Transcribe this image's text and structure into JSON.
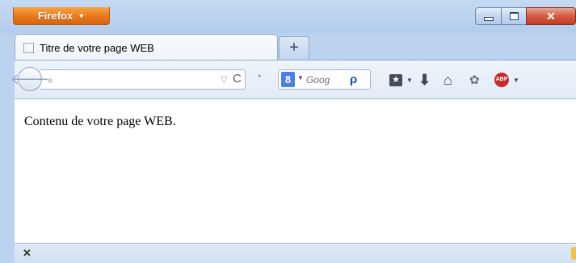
{
  "firefox_menu": {
    "label": "Firefox",
    "caret": "▼"
  },
  "window_controls": {
    "close_glyph": "✕"
  },
  "tab": {
    "title": "Titre de votre page WEB"
  },
  "new_tab": {
    "label": "+"
  },
  "navigation": {
    "back_glyph": "🡐",
    "url_value": "",
    "star_dropdown_glyph": "▽",
    "reload_glyph": "C"
  },
  "search": {
    "engine_letter": "8",
    "dropdown_glyph": "▼",
    "placeholder": "Goog",
    "go_glyph": "ρ"
  },
  "toolbar": {
    "bookmarks_glyph": "★",
    "dropdown_glyph": "▼",
    "downloads_glyph": "⬇",
    "home_glyph": "⌂",
    "social_glyph": "✿",
    "abp_label": "ABP"
  },
  "page": {
    "content": "Contenu de votre page WEB."
  },
  "addon_bar": {
    "close_glyph": "✕"
  },
  "colors": {
    "firefox_orange": "#e8781b",
    "window_frame": "#b3cdee",
    "close_red": "#c03c23",
    "search_blue": "#4a7ee8",
    "abp_red": "#c52b2b"
  }
}
